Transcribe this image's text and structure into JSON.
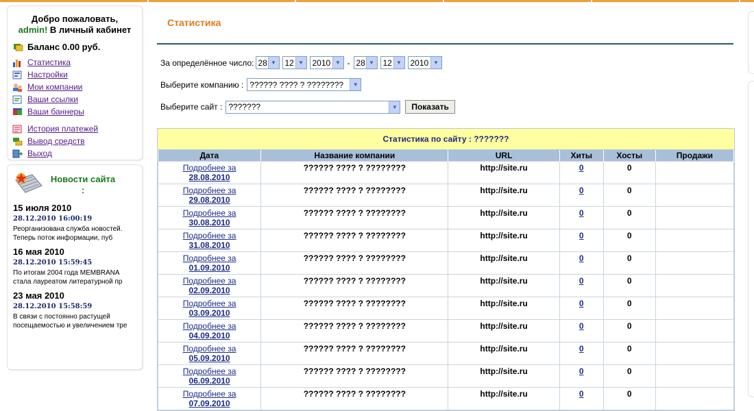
{
  "sidebar": {
    "welcome_line1": "Добро пожаловать,",
    "username": "admin!",
    "welcome_line2": " В личный кабинет",
    "balance": "Баланс 0.00 руб.",
    "menu": [
      {
        "label": "Статистика",
        "icon": "bar-chart-icon"
      },
      {
        "label": "Настройки",
        "icon": "settings-icon"
      },
      {
        "label": "Мои компании",
        "icon": "users-icon"
      },
      {
        "label": "Ваши ссылки",
        "icon": "links-icon"
      },
      {
        "label": "Ваши баннеры",
        "icon": "banners-icon"
      },
      {
        "label": "История платежей",
        "icon": "history-icon"
      },
      {
        "label": "Вывод средств",
        "icon": "withdraw-icon"
      },
      {
        "label": "Выход",
        "icon": "exit-icon"
      }
    ]
  },
  "news": {
    "title": "Новости сайта :",
    "items": [
      {
        "date": "15 июля 2010",
        "time": "28.12.2010 16:00:19",
        "text": "Реорганизована служба новостей. Теперь поток информации, пуб"
      },
      {
        "date": "16 мая 2010",
        "time": "28.12.2010 15:59:45",
        "text": "По итогам 2004 года MEMBRANA стала лауреатом литературной пр"
      },
      {
        "date": "23 мая 2010",
        "time": "28.12.2010 15:58:59",
        "text": "В связи с постоянно растущей посещаемостью и увеличением тре"
      }
    ]
  },
  "main": {
    "title": "Статистика",
    "filter": {
      "date_label": "За определённое число:",
      "from": {
        "day": "28",
        "month": "12",
        "year": "2010"
      },
      "to": {
        "day": "28",
        "month": "12",
        "year": "2010"
      },
      "company_label": "Выберите компанию :",
      "company_value": "?????? ???? ? ????????",
      "site_label": "Выберите сайт :",
      "site_value": "???????",
      "submit_label": "Показать"
    },
    "table": {
      "caption": "Статистика по сайту : ???????",
      "headers": [
        "Дата",
        "Название компании",
        "URL",
        "Хиты",
        "Хосты",
        "Продажи"
      ],
      "row_link_prefix": "Подробнее за",
      "rows": [
        {
          "date": "28.08.2010",
          "company": "?????? ???? ? ????????",
          "url": "http://site.ru",
          "hits": "0",
          "hosts": "0",
          "sales": ""
        },
        {
          "date": "29.08.2010",
          "company": "?????? ???? ? ????????",
          "url": "http://site.ru",
          "hits": "0",
          "hosts": "0",
          "sales": ""
        },
        {
          "date": "30.08.2010",
          "company": "?????? ???? ? ????????",
          "url": "http://site.ru",
          "hits": "0",
          "hosts": "0",
          "sales": ""
        },
        {
          "date": "31.08.2010",
          "company": "?????? ???? ? ????????",
          "url": "http://site.ru",
          "hits": "0",
          "hosts": "0",
          "sales": ""
        },
        {
          "date": "01.09.2010",
          "company": "?????? ???? ? ????????",
          "url": "http://site.ru",
          "hits": "0",
          "hosts": "0",
          "sales": ""
        },
        {
          "date": "02.09.2010",
          "company": "?????? ???? ? ????????",
          "url": "http://site.ru",
          "hits": "0",
          "hosts": "0",
          "sales": ""
        },
        {
          "date": "03.09.2010",
          "company": "?????? ???? ? ????????",
          "url": "http://site.ru",
          "hits": "0",
          "hosts": "0",
          "sales": ""
        },
        {
          "date": "04.09.2010",
          "company": "?????? ???? ? ????????",
          "url": "http://site.ru",
          "hits": "0",
          "hosts": "0",
          "sales": ""
        },
        {
          "date": "05.09.2010",
          "company": "?????? ???? ? ????????",
          "url": "http://site.ru",
          "hits": "0",
          "hosts": "0",
          "sales": ""
        },
        {
          "date": "06.09.2010",
          "company": "?????? ???? ? ????????",
          "url": "http://site.ru",
          "hits": "0",
          "hosts": "0",
          "sales": ""
        },
        {
          "date": "07.09.2010",
          "company": "?????? ???? ? ????????",
          "url": "http://site.ru",
          "hits": "0",
          "hosts": "0",
          "sales": ""
        }
      ]
    }
  },
  "colors": {
    "accent_orange": "#e07a1a",
    "top_bar": "#f0a030",
    "caption_bg": "#ffffa0",
    "header_bg": "#a8bfda",
    "link": "#551a8b",
    "welcome_green": "#1a7a1a"
  }
}
